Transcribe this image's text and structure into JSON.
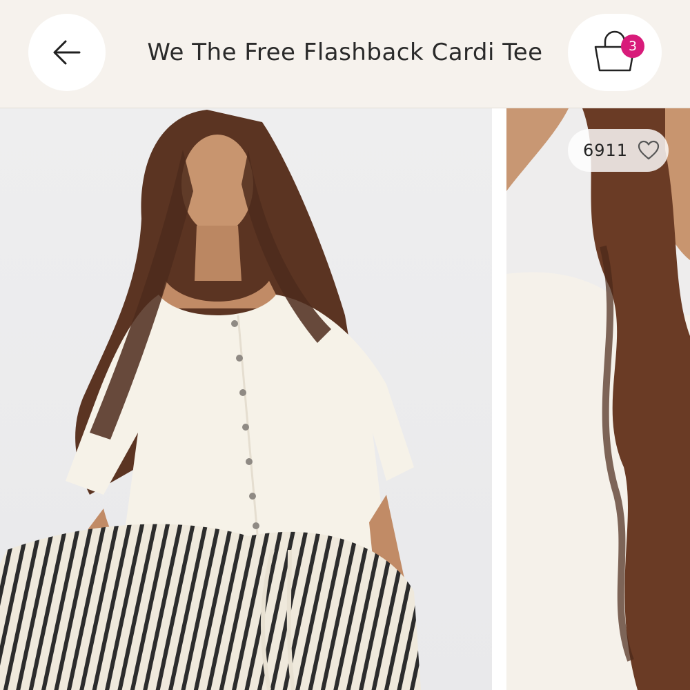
{
  "header": {
    "title": "We The Free Flashback Cardi Tee",
    "back_icon": "arrow-left-icon",
    "cart_icon": "shopping-bag-icon",
    "cart_count": "3",
    "badge_color": "#d81b7a"
  },
  "gallery": {
    "like_count": "6911",
    "like_icon": "heart-outline-icon"
  }
}
